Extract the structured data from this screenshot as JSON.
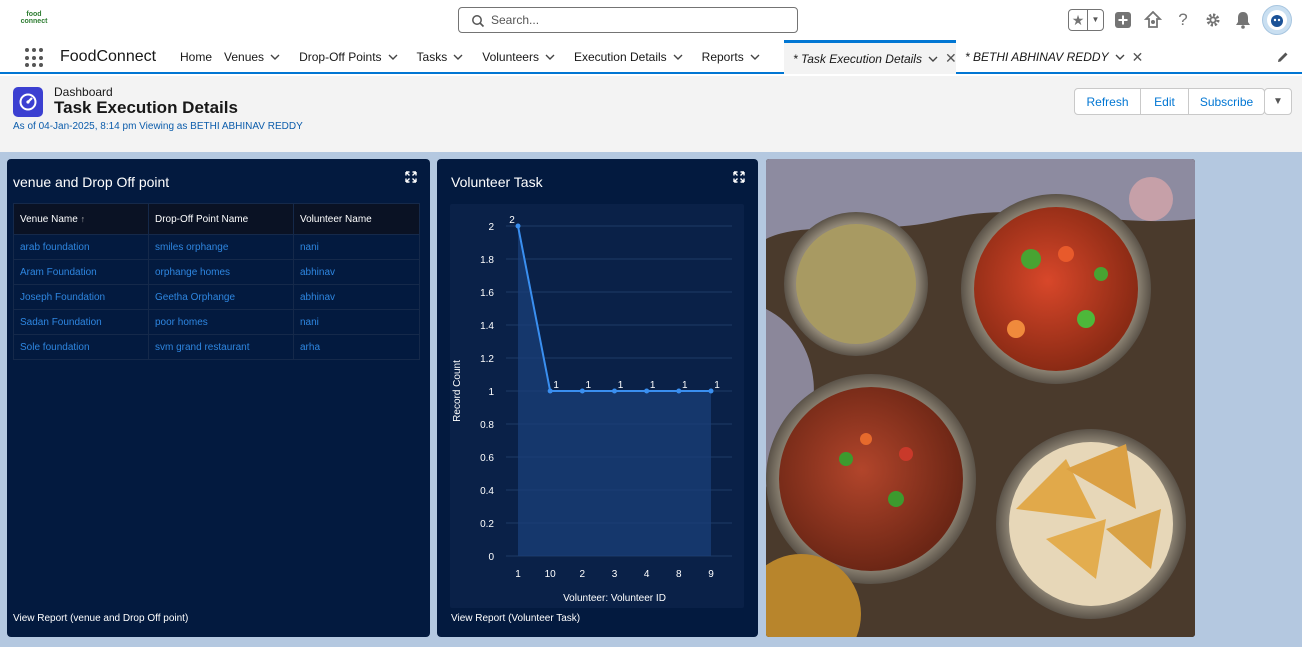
{
  "header": {
    "logo_text_line1": "food",
    "logo_text_line2": "connect",
    "search_placeholder": "Search..."
  },
  "nav": {
    "app_name": "FoodConnect",
    "items": [
      {
        "label": "Home",
        "has_menu": false
      },
      {
        "label": "Venues",
        "has_menu": true
      },
      {
        "label": "Drop-Off Points",
        "has_menu": true
      },
      {
        "label": "Tasks",
        "has_menu": true
      },
      {
        "label": "Volunteers",
        "has_menu": true
      },
      {
        "label": "Execution Details",
        "has_menu": true
      },
      {
        "label": "Reports",
        "has_menu": true
      }
    ],
    "open_tabs": [
      {
        "label": "* Task Execution Details",
        "active": true
      },
      {
        "label": "* BETHI ABHINAV REDDY",
        "active": false
      }
    ]
  },
  "dashboard": {
    "type_label": "Dashboard",
    "title": "Task Execution Details",
    "meta": "As of 04-Jan-2025, 8:14 pm Viewing as BETHI ABHINAV REDDY",
    "buttons": {
      "refresh": "Refresh",
      "edit": "Edit",
      "subscribe": "Subscribe"
    },
    "accent_color": "#3b3fd1"
  },
  "table_widget": {
    "title": "venue and Drop Off point",
    "columns": [
      "Venue Name",
      "Drop-Off Point Name",
      "Volunteer Name"
    ],
    "sort_indicator": "↑",
    "rows": [
      [
        "arab foundation",
        "smiles orphange",
        "nani"
      ],
      [
        "Aram Foundation",
        "orphange homes",
        "abhinav"
      ],
      [
        "Joseph Foundation",
        "Geetha Orphange",
        "abhinav"
      ],
      [
        "Sadan Foundation",
        "poor homes",
        "nani"
      ],
      [
        "Sole foundation",
        "svm grand restaurant",
        "arha"
      ]
    ],
    "footer": "View Report (venue and Drop Off point)"
  },
  "chart_widget": {
    "title": "Volunteer Task",
    "footer": "View Report (Volunteer Task)"
  },
  "chart_data": {
    "type": "line",
    "title": "Volunteer Task",
    "xlabel": "Volunteer: Volunteer ID",
    "ylabel": "Record Count",
    "categories": [
      "1",
      "10",
      "2",
      "3",
      "4",
      "8",
      "9"
    ],
    "values": [
      2,
      1,
      1,
      1,
      1,
      1,
      1
    ],
    "ylim": [
      0,
      2
    ],
    "yticks": [
      "0",
      "0.2",
      "0.4",
      "0.6",
      "0.8",
      "1",
      "1.2",
      "1.4",
      "1.6",
      "1.8",
      "2"
    ],
    "data_labels": true,
    "line_color": "#3a8ff0",
    "fill_color": "#1a3f78",
    "grid": true
  },
  "image_widget": {
    "description_icon": "food-photo"
  }
}
